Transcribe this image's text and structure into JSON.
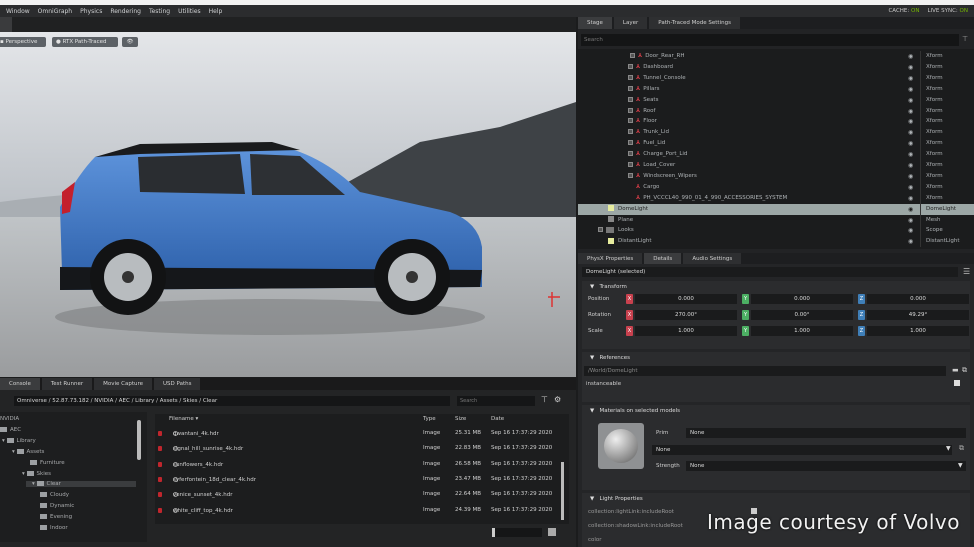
{
  "menu": [
    "Window",
    "OmniGraph",
    "Physics",
    "Rendering",
    "Testing",
    "Utilities",
    "Help"
  ],
  "status": {
    "cache_label": "CACHE:",
    "cache_value": "ON",
    "livesync_label": "LIVE SYNC:",
    "livesync_value": "ON"
  },
  "viewport": {
    "camera": "Perspective",
    "renderer": "RTX Path-Traced",
    "eye": "👁"
  },
  "stage": {
    "tabs": [
      "Stage",
      "Layer",
      "Path-Traced Mode Settings"
    ],
    "search_placeholder": "Search",
    "rows": [
      {
        "name": "Door_Rear_RH",
        "type": "Xform"
      },
      {
        "name": "Dashboard",
        "type": "Xform"
      },
      {
        "name": "Tunnel_Console",
        "type": "Xform"
      },
      {
        "name": "Pillars",
        "type": "Xform"
      },
      {
        "name": "Seats",
        "type": "Xform"
      },
      {
        "name": "Roof",
        "type": "Xform"
      },
      {
        "name": "Floor",
        "type": "Xform"
      },
      {
        "name": "Trunk_Lid",
        "type": "Xform"
      },
      {
        "name": "Fuel_Lid",
        "type": "Xform"
      },
      {
        "name": "Charge_Port_Lid",
        "type": "Xform"
      },
      {
        "name": "Load_Cover",
        "type": "Xform"
      },
      {
        "name": "Windscreen_Wipers",
        "type": "Xform"
      },
      {
        "name": "Cargo",
        "type": "Xform"
      },
      {
        "name": "PH_VCCCL40_990_01_4_990_ACCESSORIES_SYSTEM",
        "type": "Xform"
      },
      {
        "name": "DomeLight",
        "type": "DomeLight"
      },
      {
        "name": "Plane",
        "type": "Mesh"
      },
      {
        "name": "Looks",
        "type": "Scope"
      },
      {
        "name": "DistantLight",
        "type": "DistantLight"
      }
    ]
  },
  "properties": {
    "tabs": [
      "PhysX Properties",
      "Details",
      "Audio Settings"
    ],
    "selected": "DomeLight (selected)",
    "transform": {
      "title": "Transform",
      "rows": [
        {
          "label": "Position",
          "x": "0.000",
          "y": "0.000",
          "z": "0.000"
        },
        {
          "label": "Rotation",
          "x": "270.00°",
          "y": "0.00°",
          "z": "49.29°"
        },
        {
          "label": "Scale",
          "x": "1.000",
          "y": "1.000",
          "z": "1.000"
        }
      ]
    },
    "axes": {
      "x": "X",
      "y": "Y",
      "z": "Z"
    },
    "references": {
      "title": "References",
      "path": "/World/DomeLight",
      "instanceable": "instanceable"
    },
    "materials": {
      "title": "Materials on selected models",
      "prim_label": "Prim",
      "prim_value": "None",
      "material_value": "None",
      "strength_label": "Strength",
      "strength_value": "None"
    },
    "light": {
      "title": "Light Properties",
      "rows": [
        "collection:lightLink:includeRoot",
        "collection:shadowLink:includeRoot",
        "color"
      ]
    }
  },
  "content": {
    "tabs": [
      "Console",
      "Test Runner",
      "Movie Capture",
      "USD Paths"
    ],
    "path": "Omniverse / 52.87.73.182 / NVIDIA / AEC / Library / Assets / Skies / Clear",
    "search_placeholder": "Search",
    "tree": [
      "NVIDIA",
      "AEC",
      "Library",
      "Assets",
      "Furniture",
      "Skies",
      "Clear",
      "Cloudy",
      "Dynamic",
      "Evening",
      "Indoor"
    ],
    "columns": [
      "Filename ▾",
      "Type",
      "Size",
      "Date"
    ],
    "files": [
      {
        "name": "qwantani_4k.hdr",
        "type": "Image",
        "size": "25.31 MB",
        "date": "Sep 16 17:37:29 2020"
      },
      {
        "name": "signal_hill_sunrise_4k.hdr",
        "type": "Image",
        "size": "22.83 MB",
        "date": "Sep 16 17:37:29 2020"
      },
      {
        "name": "sunflowers_4k.hdr",
        "type": "Image",
        "size": "26.58 MB",
        "date": "Sep 16 17:37:29 2020"
      },
      {
        "name": "syferfontein_18d_clear_4k.hdr",
        "type": "Image",
        "size": "23.47 MB",
        "date": "Sep 16 17:37:29 2020"
      },
      {
        "name": "venice_sunset_4k.hdr",
        "type": "Image",
        "size": "22.64 MB",
        "date": "Sep 16 17:37:29 2020"
      },
      {
        "name": "white_cliff_top_4k.hdr",
        "type": "Image",
        "size": "24.39 MB",
        "date": "Sep 16 17:37:29 2020"
      }
    ]
  },
  "credit": "Image courtesy of Volvo",
  "colors": {
    "accent": "#76b900",
    "axis_x": "#c8414e",
    "axis_y": "#4caf63",
    "axis_z": "#3f7fb8",
    "selection": "#9ca7a6",
    "car_blue": "#3b73c4"
  }
}
